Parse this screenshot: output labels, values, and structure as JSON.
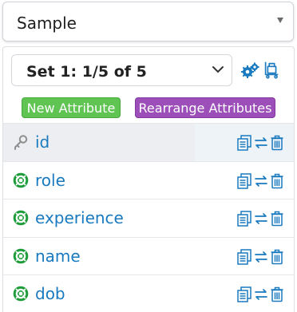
{
  "sample_select": {
    "value": "Sample"
  },
  "set_select": {
    "value": "Set 1: 1/5 of 5"
  },
  "toolbar": {
    "gear_icon": "gears-icon",
    "trolley_icon": "trolley-icon"
  },
  "buttons": {
    "new_attribute": "New Attribute",
    "rearrange_attributes": "Rearrange Attributes"
  },
  "colors": {
    "link_blue": "#1a7abf",
    "green_button": "#5fc452",
    "purple_button": "#9c4fb8",
    "lifebuoy_green": "#1e9c3a"
  },
  "attributes": [
    {
      "name": "id",
      "icon": "key-icon",
      "selected": true
    },
    {
      "name": "role",
      "icon": "lifebuoy-icon",
      "selected": false
    },
    {
      "name": "experience",
      "icon": "lifebuoy-icon",
      "selected": false
    },
    {
      "name": "name",
      "icon": "lifebuoy-icon",
      "selected": false
    },
    {
      "name": "dob",
      "icon": "lifebuoy-icon",
      "selected": false
    }
  ]
}
